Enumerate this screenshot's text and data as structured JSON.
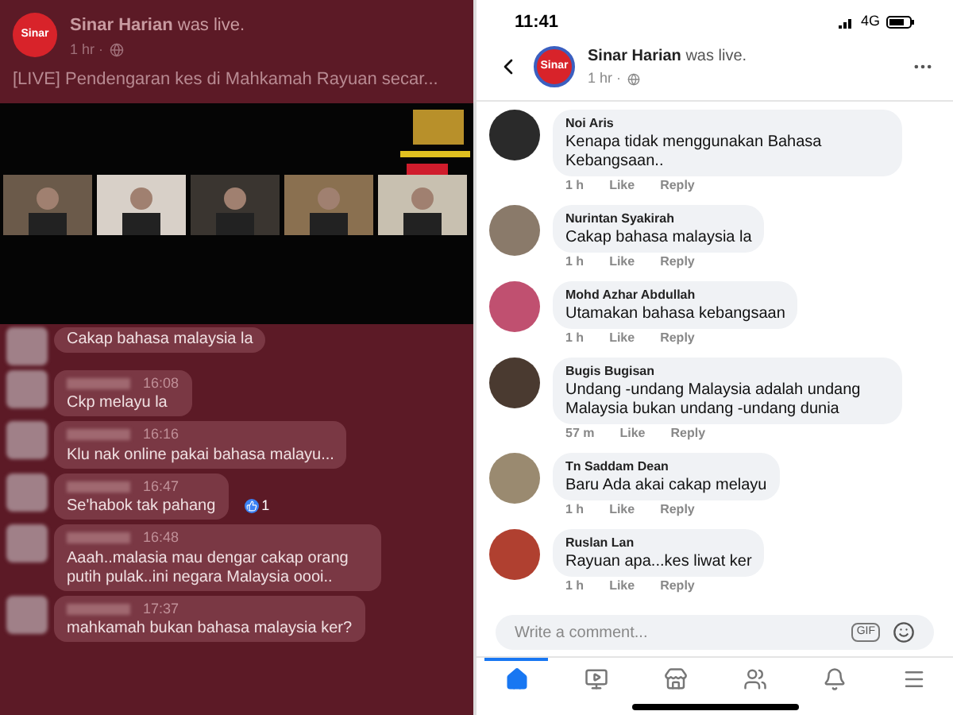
{
  "live_panel": {
    "header": {
      "logo_text": "Sinar",
      "page_name": "Sinar Harian",
      "action": "was live.",
      "time": "1 hr ·",
      "title": "[LIVE] Pendengaran kes di Mahkamah Rayuan secar..."
    },
    "comments": [
      {
        "text": "Cakap bahasa malaysia la"
      },
      {
        "time": "16:08",
        "text": "Ckp melayu la"
      },
      {
        "time": "16:16",
        "text": "Klu nak online pakai bahasa malayu..."
      },
      {
        "time": "16:47",
        "text": "Se'habok tak pahang",
        "reactions": "1"
      },
      {
        "time": "16:48",
        "text": "Aaah..malasia mau dengar cakap orang putih pulak..ini negara Malaysia oooi.."
      },
      {
        "time": "17:37",
        "text": "mahkamah bukan bahasa malaysia ker?"
      }
    ]
  },
  "post_panel": {
    "status_bar": {
      "time": "11:41",
      "network": "4G"
    },
    "header": {
      "logo_text": "Sinar",
      "page_name": "Sinar Harian",
      "action": "was live.",
      "time": "1 hr ·"
    },
    "comments": [
      {
        "name": "Noi Aris",
        "text": "Kenapa tidak menggunakan Bahasa Kebangsaan..",
        "time": "1 h",
        "like": "Like",
        "reply": "Reply"
      },
      {
        "name": "Nurintan Syakirah",
        "text": "Cakap bahasa malaysia la",
        "time": "1 h",
        "like": "Like",
        "reply": "Reply"
      },
      {
        "name": "Mohd Azhar Abdullah",
        "text": "Utamakan bahasa kebangsaan",
        "time": "1 h",
        "like": "Like",
        "reply": "Reply"
      },
      {
        "name": "Bugis Bugisan",
        "text": "Undang -undang Malaysia adalah undang Malaysia bukan undang -undang dunia",
        "time": "57 m",
        "like": "Like",
        "reply": "Reply"
      },
      {
        "name": "Tn Saddam Dean",
        "text": "Baru Ada akai cakap melayu",
        "time": "1 h",
        "like": "Like",
        "reply": "Reply"
      },
      {
        "name": "Ruslan Lan",
        "text": "Rayuan apa...kes liwat ker",
        "time": "1 h",
        "like": "Like",
        "reply": "Reply"
      }
    ],
    "composer": {
      "placeholder": "Write a comment...",
      "gif": "GIF"
    },
    "nav": [
      {
        "selected": true
      },
      {
        "selected": false
      },
      {
        "selected": false
      },
      {
        "selected": false
      },
      {
        "selected": false
      },
      {
        "selected": false
      }
    ]
  }
}
